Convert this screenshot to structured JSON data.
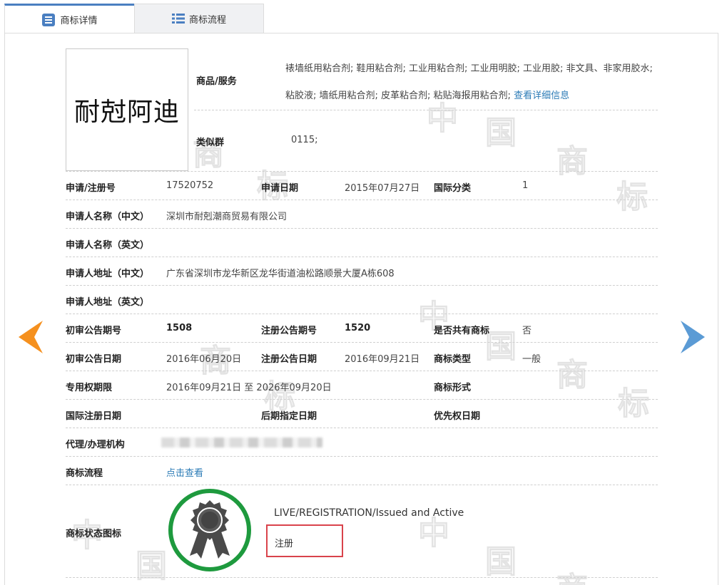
{
  "tabs": [
    {
      "label": "商标详情",
      "active": true
    },
    {
      "label": "商标流程",
      "active": false
    }
  ],
  "watermark": [
    "中",
    "国",
    "商",
    "标"
  ],
  "logo_text": "耐尅阿迪",
  "goods": {
    "label": "商品/服务",
    "text": "裱墙纸用粘合剂; 鞋用粘合剂; 工业用粘合剂; 工业用明胶; 工业用胶; 非文具、非家用胶水; 粘胶液; 墙纸用粘合剂; 皮革粘合剂; 粘贴海报用粘合剂;",
    "detail_link": "查看详细信息"
  },
  "similar_group": {
    "label": "类似群",
    "value": "0115;"
  },
  "fields": {
    "reg_no_label": "申请/注册号",
    "reg_no": "17520752",
    "apply_date_label": "申请日期",
    "apply_date": "2015年07月27日",
    "intl_class_label": "国际分类",
    "intl_class": "1",
    "applicant_cn_label": "申请人名称（中文）",
    "applicant_cn": "深圳市耐剋潮商贸易有限公司",
    "applicant_en_label": "申请人名称（英文）",
    "applicant_en": "",
    "address_cn_label": "申请人地址（中文）",
    "address_cn": "广东省深圳市龙华新区龙华街道油松路顺景大厦A栋608",
    "address_en_label": "申请人地址（英文）",
    "address_en": "",
    "prelim_no_label": "初审公告期号",
    "prelim_no": "1508",
    "reg_pub_no_label": "注册公告期号",
    "reg_pub_no": "1520",
    "shared_label": "是否共有商标",
    "shared": "否",
    "prelim_date_label": "初审公告日期",
    "prelim_date": "2016年06月20日",
    "reg_pub_date_label": "注册公告日期",
    "reg_pub_date": "2016年09月21日",
    "tm_type_label": "商标类型",
    "tm_type": "一般",
    "exclusive_label": "专用权期限",
    "exclusive": "2016年09月21日 至 2026年09月20日",
    "tm_form_label": "商标形式",
    "tm_form": "",
    "intl_reg_date_label": "国际注册日期",
    "intl_reg_date": "",
    "later_date_label": "后期指定日期",
    "later_date": "",
    "priority_date_label": "优先权日期",
    "priority_date": "",
    "agent_label": "代理/办理机构",
    "flow_label": "商标流程",
    "flow_link": "点击查看",
    "status_icon_label": "商标状态图标",
    "status_en": "LIVE/REGISTRATION/Issued and Active",
    "status_cn": "注册"
  },
  "colors": {
    "accent": "#4a7fc1",
    "link": "#2b7bb6",
    "left_arrow": "#f5901e",
    "right_arrow": "#5b9bd5",
    "seal_ring": "#1e9a3e",
    "status_border": "#d9434b"
  }
}
